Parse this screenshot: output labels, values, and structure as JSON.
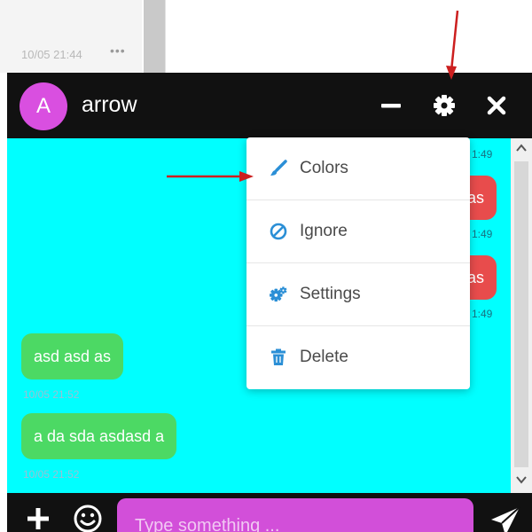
{
  "background": {
    "timestamp": "10/05 21:44",
    "more_dots": "•••"
  },
  "chat": {
    "avatar_letter": "A",
    "name": "arrow",
    "header_icons": [
      "minimize-icon",
      "gear-icon",
      "close-icon"
    ],
    "messages_left": [
      {
        "text": "asd asd as",
        "time": "10/05 21:52"
      },
      {
        "text": "a da sda asdasd a",
        "time": "10/05 21:52"
      }
    ],
    "messages_right_partial": [
      {
        "time": "1:49"
      },
      {
        "text": "as",
        "time": "1:49"
      },
      {
        "text": "as",
        "time": "1:49"
      }
    ],
    "composer": {
      "placeholder": "Type something ...",
      "value": ""
    }
  },
  "menu": {
    "items": [
      {
        "label": "Colors",
        "icon": "paint-brush-icon"
      },
      {
        "label": "Ignore",
        "icon": "ban-icon"
      },
      {
        "label": "Settings",
        "icon": "cogs-icon"
      },
      {
        "label": "Delete",
        "icon": "trash-icon"
      }
    ]
  },
  "colors": {
    "header_bg": "#111111",
    "chat_bg": "#00ffff",
    "avatar": "#d94fe0",
    "bubble_left": "#4cd964",
    "bubble_right": "#e84c4c",
    "input_bg": "#d24fd9",
    "menu_icon": "#2b8fd6",
    "annotation_arrow": "#cc1f1f"
  }
}
